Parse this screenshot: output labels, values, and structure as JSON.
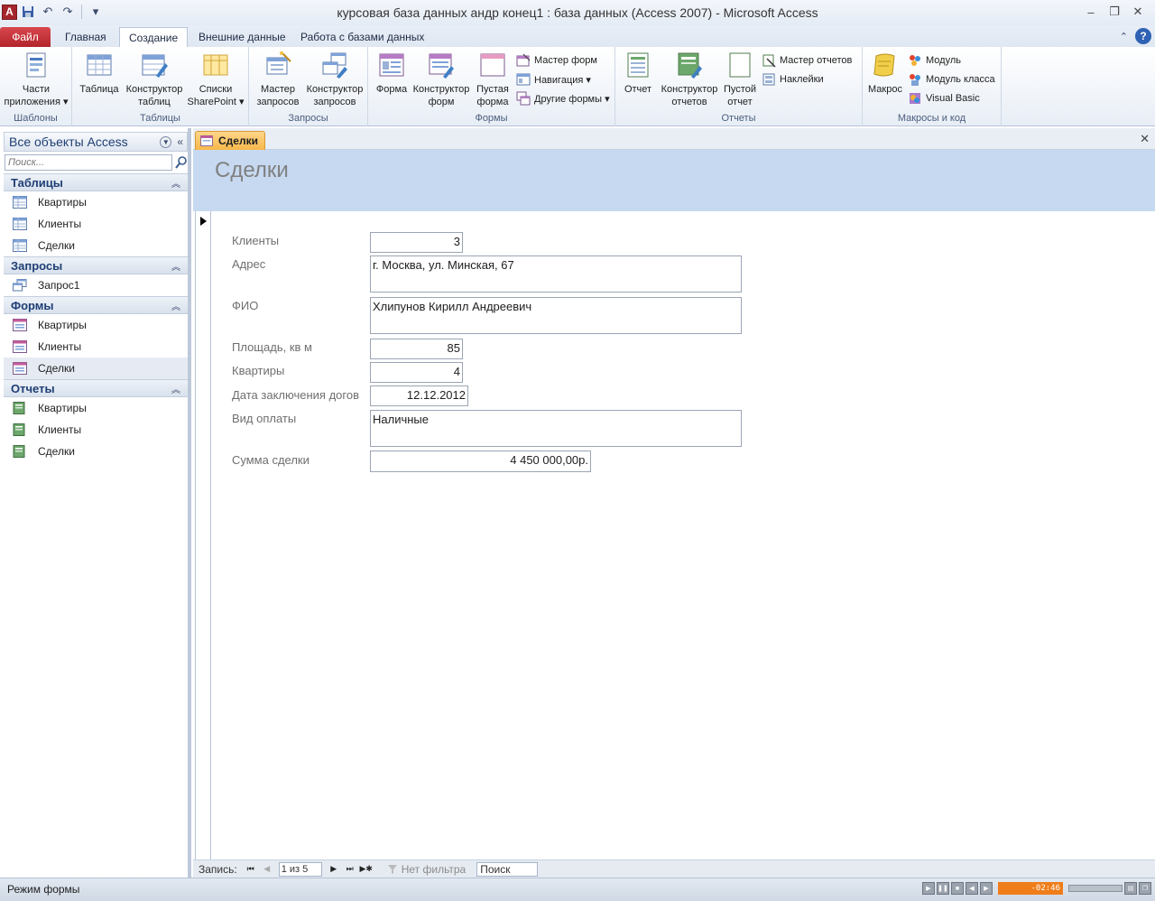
{
  "window": {
    "title": "курсовая база данных андр конец1 : база данных (Access 2007)  -  Microsoft Access",
    "app_icon_letter": "A"
  },
  "ribbon_tabs": [
    {
      "label": "Файл"
    },
    {
      "label": "Главная"
    },
    {
      "label": "Создание"
    },
    {
      "label": "Внешние данные"
    },
    {
      "label": "Работа с базами данных"
    }
  ],
  "ribbon": {
    "templates": {
      "label": "Шаблоны",
      "parts_line1": "Части",
      "parts_line2": "приложения ▾"
    },
    "tables": {
      "label": "Таблицы",
      "table": "Таблица",
      "designer_line1": "Конструктор",
      "designer_line2": "таблиц",
      "sp_line1": "Списки",
      "sp_line2": "SharePoint ▾"
    },
    "queries": {
      "label": "Запросы",
      "wizard_line1": "Мастер",
      "wizard_line2": "запросов",
      "designer_line1": "Конструктор",
      "designer_line2": "запросов"
    },
    "forms": {
      "label": "Формы",
      "form": "Форма",
      "designer_line1": "Конструктор",
      "designer_line2": "форм",
      "blank_line1": "Пустая",
      "blank_line2": "форма",
      "wizard": "Мастер форм",
      "navigation": "Навигация ▾",
      "other": "Другие формы ▾"
    },
    "reports": {
      "label": "Отчеты",
      "report": "Отчет",
      "designer_line1": "Конструктор",
      "designer_line2": "отчетов",
      "blank_line1": "Пустой",
      "blank_line2": "отчет",
      "wizard": "Мастер отчетов",
      "labels": "Наклейки"
    },
    "macros": {
      "label": "Макросы и код",
      "macro": "Макрос",
      "module": "Модуль",
      "class_module": "Модуль класса",
      "vb": "Visual Basic"
    }
  },
  "nav_pane": {
    "title": "Все объекты Access",
    "search_placeholder": "Поиск...",
    "sections": [
      {
        "title": "Таблицы",
        "items": [
          "Квартиры",
          "Клиенты",
          "Сделки"
        ]
      },
      {
        "title": "Запросы",
        "items": [
          "Запрос1"
        ]
      },
      {
        "title": "Формы",
        "items": [
          "Квартиры",
          "Клиенты",
          "Сделки"
        ]
      },
      {
        "title": "Отчеты",
        "items": [
          "Квартиры",
          "Клиенты",
          "Сделки"
        ]
      }
    ]
  },
  "document": {
    "tab_label": "Сделки",
    "form_title": "Сделки",
    "fields": {
      "clients_label": "Клиенты",
      "clients_value": "3",
      "address_label": "Адрес",
      "address_value": "г. Москва, ул. Минская, 67",
      "fio_label": "ФИО",
      "fio_value": "Хлипунов Кирилл Андреевич",
      "area_label": "Площадь, кв м",
      "area_value": "85",
      "flats_label": "Квартиры",
      "flats_value": "4",
      "date_label": "Дата заключения догов",
      "date_value": "12.12.2012",
      "payment_label": "Вид оплаты",
      "payment_value": "Наличные",
      "sum_label": "Сумма сделки",
      "sum_value": "4 450 000,00р."
    }
  },
  "record_nav": {
    "label": "Запись:",
    "position": "1 из 5",
    "filter": "Нет фильтра",
    "search": "Поиск"
  },
  "status": {
    "mode": "Режим формы",
    "player_time": "-02:46"
  }
}
